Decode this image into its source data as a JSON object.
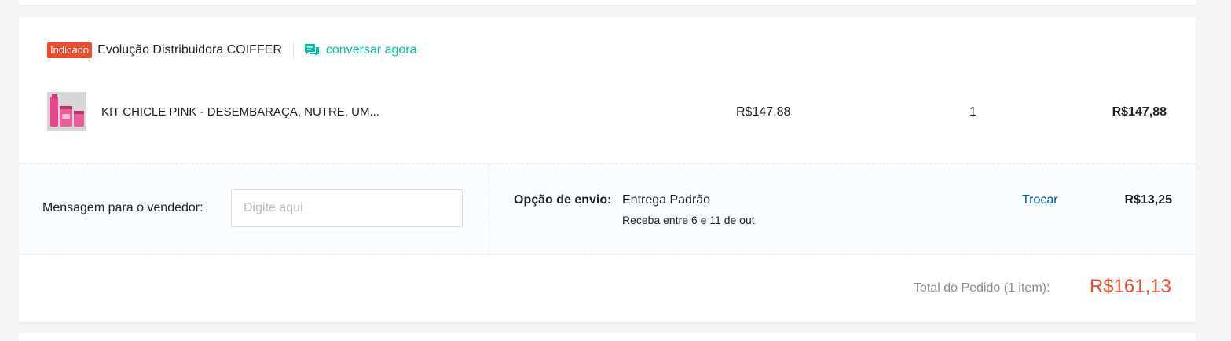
{
  "shop": {
    "badge": "Indicado",
    "name": "Evolução Distribuidora COIFFER",
    "chat_label": "conversar agora"
  },
  "item": {
    "name": "KIT CHICLE PINK - DESEMBARAÇA, NUTRE, UM...",
    "unit_price": "R$147,88",
    "quantity": "1",
    "subtotal": "R$147,88"
  },
  "message": {
    "label": "Mensagem para o vendedor:",
    "placeholder": "Digite aqui",
    "value": ""
  },
  "shipping": {
    "label": "Opção de envio:",
    "method": "Entrega Padrão",
    "eta": "Receba entre 6 e 11 de out",
    "change_label": "Trocar",
    "price": "R$13,25"
  },
  "order_total": {
    "label": "Total do Pedido (1 item):",
    "value": "R$161,13"
  },
  "colors": {
    "accent": "#ee4d2d",
    "chat": "#00bfa5",
    "link": "#0055aa"
  }
}
